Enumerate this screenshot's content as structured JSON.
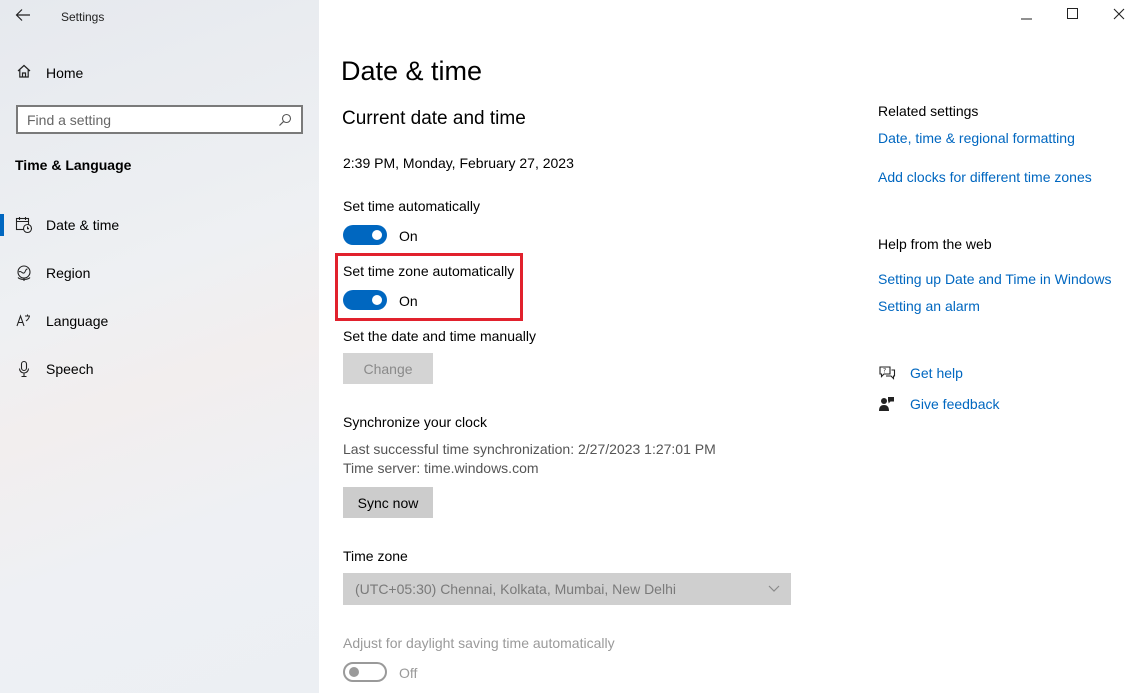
{
  "window": {
    "app_title": "Settings"
  },
  "sidebar": {
    "home_label": "Home",
    "search_placeholder": "Find a setting",
    "section_title": "Time & Language",
    "items": [
      {
        "label": "Date & time",
        "icon": "calendar-clock-icon",
        "active": true
      },
      {
        "label": "Region",
        "icon": "globe-icon",
        "active": false
      },
      {
        "label": "Language",
        "icon": "language-icon",
        "active": false
      },
      {
        "label": "Speech",
        "icon": "microphone-icon",
        "active": false
      }
    ]
  },
  "main": {
    "page_title": "Date & time",
    "section_title": "Current date and time",
    "current_datetime": "2:39 PM, Monday, February 27, 2023",
    "set_time_auto": {
      "label": "Set time automatically",
      "state": "On"
    },
    "set_timezone_auto": {
      "label": "Set time zone automatically",
      "state": "On"
    },
    "manual": {
      "label": "Set the date and time manually",
      "button": "Change"
    },
    "sync": {
      "title": "Synchronize your clock",
      "last_sync": "Last successful time synchronization: 2/27/2023 1:27:01 PM",
      "server": "Time server: time.windows.com",
      "button": "Sync now"
    },
    "time_zone": {
      "label": "Time zone",
      "selected": "(UTC+05:30) Chennai, Kolkata, Mumbai, New Delhi"
    },
    "daylight": {
      "label": "Adjust for daylight saving time automatically",
      "state": "Off"
    }
  },
  "related": {
    "title": "Related settings",
    "links": [
      "Date, time & regional formatting",
      "Add clocks for different time zones"
    ],
    "help_title": "Help from the web",
    "help_links": [
      "Setting up Date and Time in Windows",
      "Setting an alarm"
    ],
    "get_help": "Get help",
    "give_feedback": "Give feedback"
  },
  "colors": {
    "accent": "#0067c0",
    "highlight": "#e1212d"
  }
}
